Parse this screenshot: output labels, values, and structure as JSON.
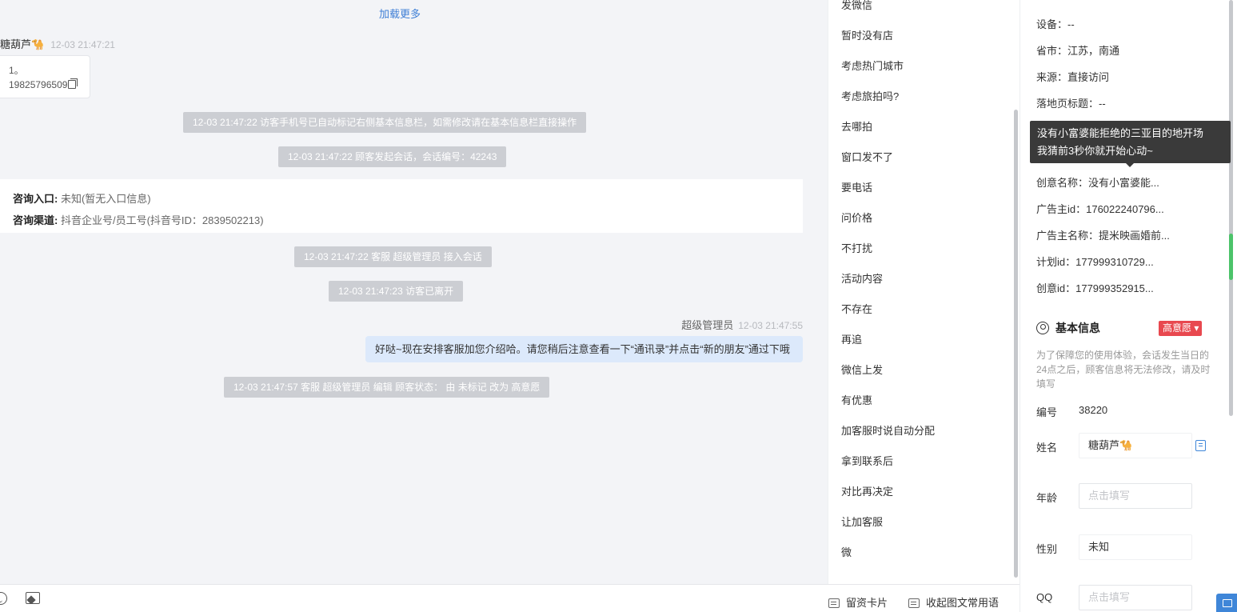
{
  "chat": {
    "load_more": "加载更多",
    "visitor_name": "糖葫芦🐪",
    "visitor_time": "12-03 21:47:21",
    "visitor_msg_line1": "1。",
    "visitor_msg_line2": "19825796509",
    "system_msgs": [
      "12-03 21:47:22 访客手机号已自动标记右侧基本信息栏，如需修改请在基本信息栏直接操作",
      "12-03 21:47:22 顾客发起会话，会话编号：42243",
      "12-03 21:47:22 客服 超级管理员 接入会话",
      "12-03 21:47:23 访客已离开",
      "12-03 21:47:57 客服 超级管理员 编辑 顾客状态： 由 未标记 改为 高意愿"
    ],
    "entry_label": "咨询入口:",
    "entry_value": "未知(暂无入口信息)",
    "channel_label": "咨询渠道:",
    "channel_value": "抖音企业号/员工号(抖音号ID：2839502213)",
    "agent_name": "超级管理员",
    "agent_time": "12-03 21:47:55",
    "agent_msg": "好哒~现在安排客服加您介绍哈。请您稍后注意查看一下“通讯录”并点击“新的朋友”通过下哦"
  },
  "toolbar": {
    "card_label": "留资卡片",
    "collapse_label": "收起图文常用语"
  },
  "quick_replies": [
    "发微信",
    "暂时没有店",
    "考虑热门城市",
    "考虑旅拍吗?",
    "去哪拍",
    "窗口发不了",
    "要电话",
    "问价格",
    "不打扰",
    "活动内容",
    "不存在",
    "再追",
    "微信上发",
    "有优惠",
    "加客服时说自动分配",
    "拿到联系后",
    "对比再决定",
    "让加客服",
    "微"
  ],
  "info": {
    "device": "设备：--",
    "province": "省市：江苏，南通",
    "source": "来源：直接访问",
    "landing_title": "落地页标题：--",
    "tooltip_line1": "没有小富婆能拒绝的三亚目的地开场",
    "tooltip_line2": "我猜前3秒你就开始心动~",
    "creative_name": "创意名称：没有小富婆能...",
    "advertiser_id": "广告主id：176022240796...",
    "advertiser_name": "广告主名称：提米映画婚前...",
    "plan_id": "计划id：177999310729...",
    "creative_id": "创意id：177999352915...",
    "section_title": "基本信息",
    "status_badge": "高意愿",
    "note": "为了保障您的使用体验，会话发生当日的24点之后，顾客信息将无法修改，请及时填写",
    "number_label": "编号",
    "number_value": "38220",
    "name_label": "姓名",
    "name_value": "糖葫芦🐪",
    "age_label": "年龄",
    "age_placeholder": "点击填写",
    "gender_label": "性别",
    "gender_value": "未知",
    "qq_label": "QQ",
    "qq_placeholder": "点击填写"
  }
}
